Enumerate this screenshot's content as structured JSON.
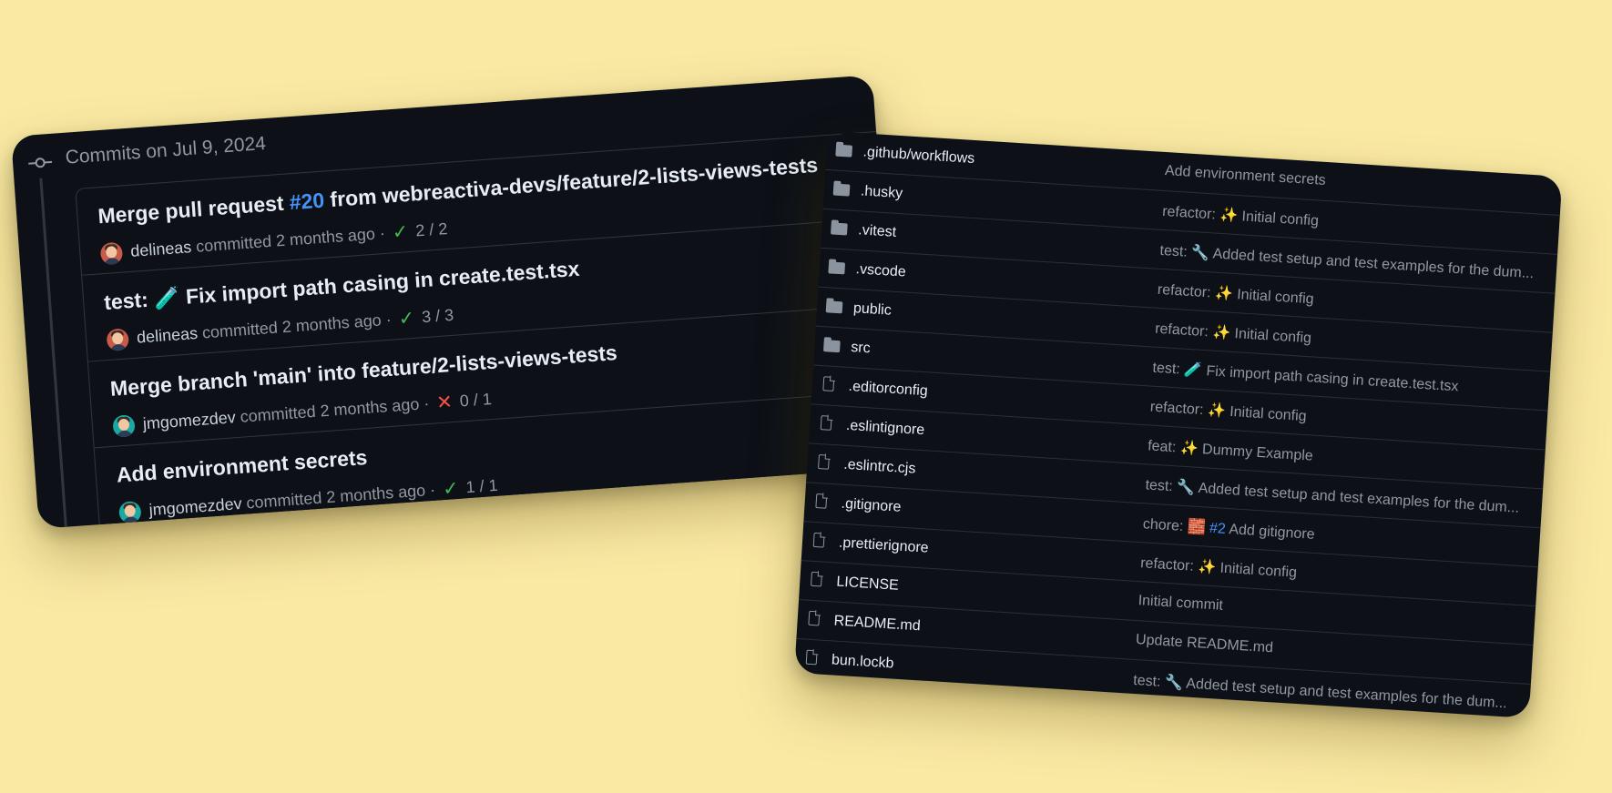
{
  "colors": {
    "background": "#f9e9a3",
    "panel": "#0d1117",
    "success": "#3fb950",
    "failure": "#f85149",
    "link": "#4493f8"
  },
  "commits": {
    "date_heading": "Commits on Jul 9, 2024",
    "items": [
      {
        "title_prefix": "Merge pull request ",
        "pr": "#20",
        "title_suffix": " from webreactiva-devs/feature/2-lists-views-tests",
        "author": "delineas",
        "committed": "committed 2 months ago",
        "separator": "·",
        "status": "success",
        "status_icon": "check-icon",
        "checks": "2 / 2",
        "avatar": "red"
      },
      {
        "title_prefix": "test: 🧪 Fix import path casing in create.test.tsx",
        "pr": "",
        "title_suffix": "",
        "author": "delineas",
        "committed": "committed 2 months ago",
        "separator": "·",
        "status": "success",
        "status_icon": "check-icon",
        "checks": "3 / 3",
        "avatar": "red"
      },
      {
        "title_prefix": "Merge branch 'main' into feature/2-lists-views-tests",
        "pr": "",
        "title_suffix": "",
        "author": "jmgomezdev",
        "committed": "committed 2 months ago",
        "separator": "·",
        "status": "failure",
        "status_icon": "x-icon",
        "checks": "0 / 1",
        "avatar": "teal"
      },
      {
        "title_prefix": "Add environment secrets",
        "pr": "",
        "title_suffix": "",
        "author": "jmgomezdev",
        "committed": "committed 2 months ago",
        "separator": "·",
        "status": "success",
        "status_icon": "check-icon",
        "checks": "1 / 1",
        "avatar": "teal"
      }
    ]
  },
  "files": {
    "rows": [
      {
        "type": "folder",
        "icon": "folder-icon",
        "name": ".github/workflows",
        "message": "Add environment secrets"
      },
      {
        "type": "folder",
        "icon": "folder-icon",
        "name": ".husky",
        "message": "refactor: ✨ Initial config"
      },
      {
        "type": "folder",
        "icon": "folder-icon",
        "name": ".vitest",
        "message": "test: 🔧 Added test setup and test examples for the dum..."
      },
      {
        "type": "folder",
        "icon": "folder-icon",
        "name": ".vscode",
        "message": "refactor: ✨ Initial config"
      },
      {
        "type": "folder",
        "icon": "folder-icon",
        "name": "public",
        "message": "refactor: ✨ Initial config"
      },
      {
        "type": "folder",
        "icon": "folder-icon",
        "name": "src",
        "message": "test: 🧪 Fix import path casing in create.test.tsx"
      },
      {
        "type": "file",
        "icon": "file-icon",
        "name": ".editorconfig",
        "message": "refactor: ✨ Initial config"
      },
      {
        "type": "file",
        "icon": "file-icon",
        "name": ".eslintignore",
        "message": "feat: ✨ Dummy Example"
      },
      {
        "type": "file",
        "icon": "file-icon",
        "name": ".eslintrc.cjs",
        "message": "test: 🔧 Added test setup and test examples for the dum..."
      },
      {
        "type": "file",
        "icon": "file-icon",
        "name": ".gitignore",
        "message_prefix": "chore: 🧱 ",
        "issue": "#2",
        "message_suffix": " Add gitignore"
      },
      {
        "type": "file",
        "icon": "file-icon",
        "name": ".prettierignore",
        "message": "refactor: ✨ Initial config"
      },
      {
        "type": "file",
        "icon": "file-icon",
        "name": "LICENSE",
        "message": "Initial commit"
      },
      {
        "type": "file",
        "icon": "file-icon",
        "name": "README.md",
        "message": "Update README.md"
      },
      {
        "type": "file",
        "icon": "file-icon",
        "name": "bun.lockb",
        "message": "test: 🔧 Added test setup and test examples for the dum..."
      }
    ]
  }
}
